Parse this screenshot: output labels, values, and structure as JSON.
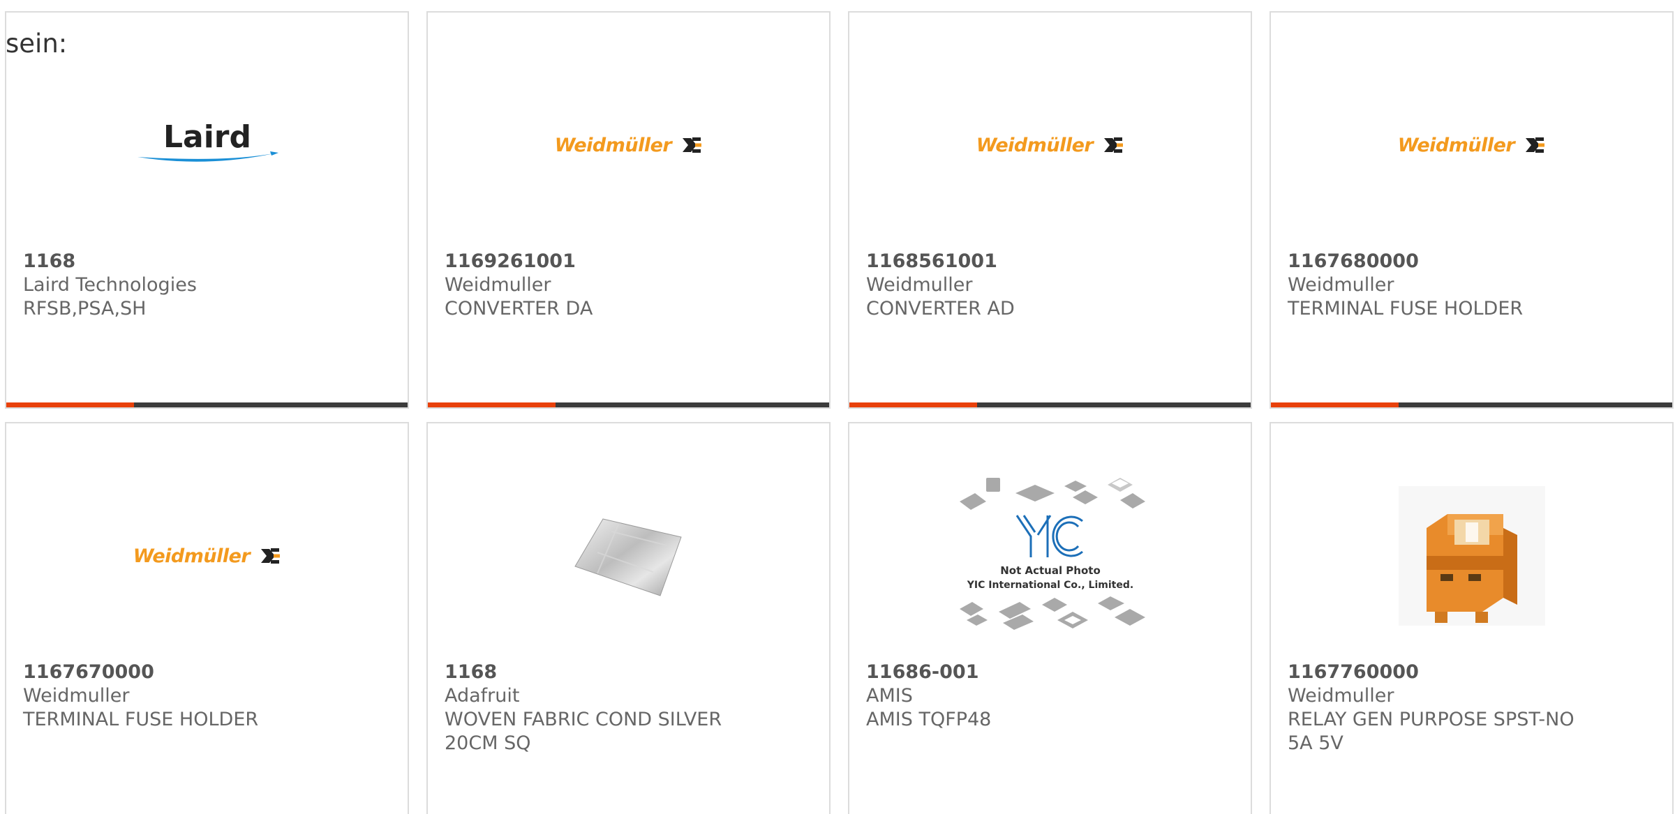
{
  "heading": "sein:",
  "colors": {
    "accent_bar": "#e8410b",
    "dark_bar": "#3c3c3c",
    "weidmuller_orange": "#f39a1e",
    "laird_blue": "#1a8fd6"
  },
  "products": [
    {
      "part_number": "1168",
      "manufacturer": "Laird Technologies",
      "description": "RFSB,PSA,SH",
      "description2": "",
      "image": "laird-logo",
      "logo_text": "Laird",
      "has_bar": true
    },
    {
      "part_number": "1169261001",
      "manufacturer": "Weidmuller",
      "description": "CONVERTER DA",
      "description2": "",
      "image": "weidmuller-logo",
      "logo_text": "Weidmüller",
      "has_bar": true
    },
    {
      "part_number": "1168561001",
      "manufacturer": "Weidmuller",
      "description": "CONVERTER AD",
      "description2": "",
      "image": "weidmuller-logo",
      "logo_text": "Weidmüller",
      "has_bar": true
    },
    {
      "part_number": "1167680000",
      "manufacturer": "Weidmuller",
      "description": "TERMINAL FUSE HOLDER",
      "description2": "",
      "image": "weidmuller-logo",
      "logo_text": "Weidmüller",
      "has_bar": true
    },
    {
      "part_number": "1167670000",
      "manufacturer": "Weidmuller",
      "description": "TERMINAL FUSE HOLDER",
      "description2": "",
      "image": "weidmuller-logo",
      "logo_text": "Weidmüller",
      "has_bar": false
    },
    {
      "part_number": "1168",
      "manufacturer": "Adafruit",
      "description": "WOVEN FABRIC COND SILVER",
      "description2": "20CM SQ",
      "image": "fabric-photo",
      "has_bar": false
    },
    {
      "part_number": "11686-001",
      "manufacturer": "AMIS",
      "description": "AMIS TQFP48",
      "description2": "",
      "image": "yic-placeholder",
      "placeholder_line1": "Not Actual Photo",
      "placeholder_line2": "YIC International Co., Limited.",
      "has_bar": false
    },
    {
      "part_number": "1167760000",
      "manufacturer": "Weidmuller",
      "description": "RELAY GEN PURPOSE SPST-NO",
      "description2": "5A 5V",
      "image": "relay-photo",
      "has_bar": false
    }
  ]
}
